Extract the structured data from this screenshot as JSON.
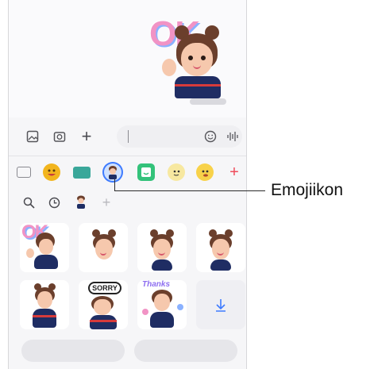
{
  "callout": {
    "label": "Emojiikon"
  },
  "composer": {
    "gallery_icon": "image-icon",
    "camera_icon": "camera-icon",
    "add_icon": "plus-icon",
    "emoji_icon": "smiley-icon",
    "voice_icon": "voice-waveform-icon"
  },
  "tabs": [
    {
      "name": "keyboard-icon"
    },
    {
      "name": "emoji-icon"
    },
    {
      "name": "gif-icon"
    },
    {
      "name": "ar-emoji-icon",
      "active": true
    },
    {
      "name": "sticker-icon"
    },
    {
      "name": "bitmoji-icon"
    },
    {
      "name": "mojitok-icon"
    },
    {
      "name": "add-icon"
    }
  ],
  "subtabs": [
    {
      "name": "search-icon"
    },
    {
      "name": "recent-icon"
    },
    {
      "name": "avatar-icon"
    },
    {
      "name": "add-icon"
    }
  ],
  "stickers": {
    "row1": [
      "ok-sticker",
      "pout-sticker",
      "smile-sticker",
      "happy-sticker"
    ],
    "row2": [
      "wave-sticker",
      "sorry-sticker",
      "thanks-sticker",
      "download-more"
    ]
  },
  "colors": {
    "accent": "#3e7bff",
    "sticker_pink": "#f193c5",
    "shirt": "#1f2d63"
  }
}
